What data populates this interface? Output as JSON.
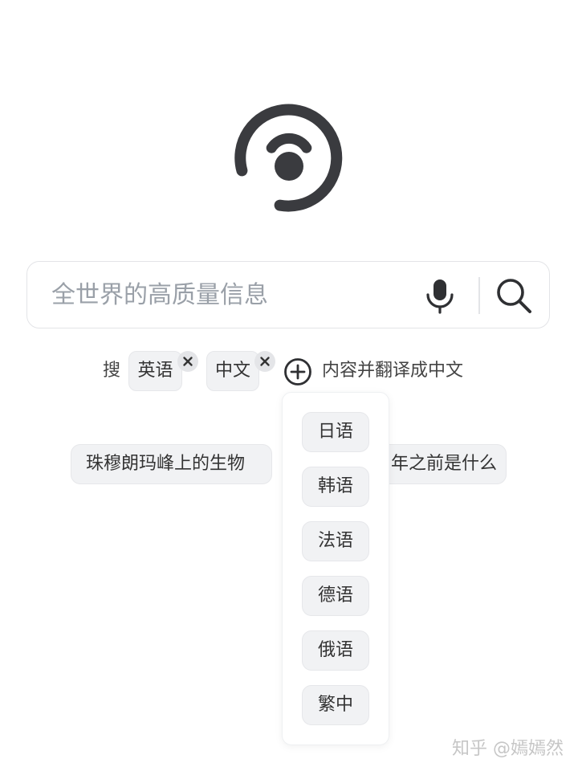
{
  "search": {
    "placeholder": "全世界的高质量信息",
    "value": ""
  },
  "language_row": {
    "prefix": "搜",
    "selected": [
      "英语",
      "中文"
    ],
    "suffix": "内容并翻译成中文"
  },
  "suggestions": [
    "珠穆朗玛峰上的生物",
    "年之前是什么"
  ],
  "language_options": [
    "日语",
    "韩语",
    "法语",
    "德语",
    "俄语",
    "繁中"
  ],
  "watermark": "知乎 @嫣嫣然",
  "colors": {
    "logo": "#3a3b3f",
    "icon": "#2f3033",
    "chip_background": "#f1f2f4",
    "border": "#e3e4e7",
    "placeholder": "#9aa0a8"
  },
  "icons": {
    "logo": "signal-logo-icon",
    "mic": "microphone-icon",
    "search": "magnifier-icon",
    "add": "plus-circle-icon",
    "remove": "close-icon"
  }
}
